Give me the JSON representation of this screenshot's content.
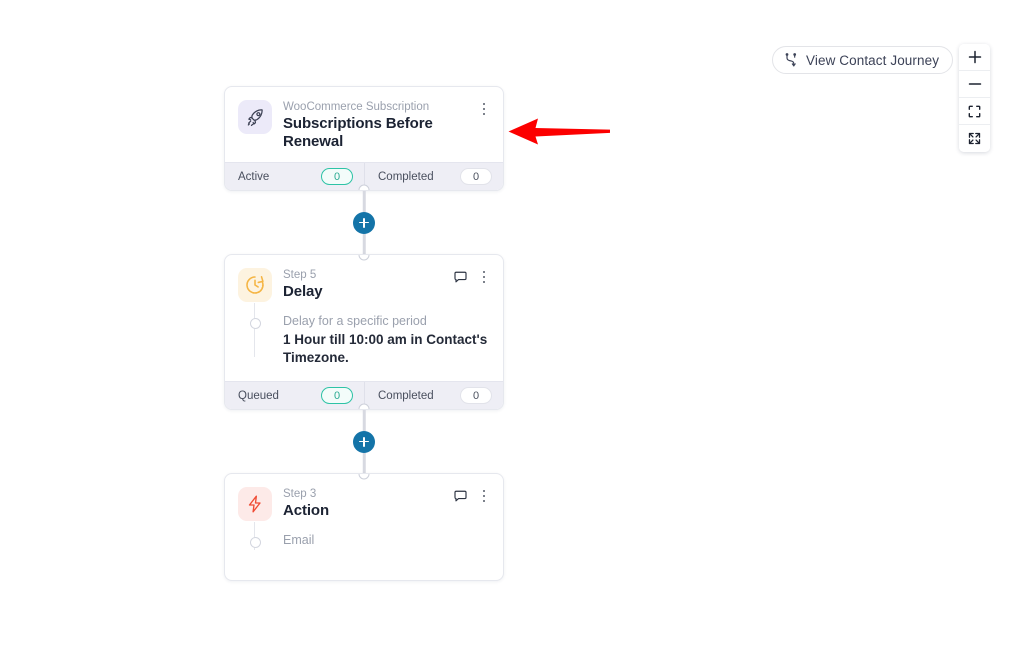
{
  "toolbar": {
    "journey_button": {
      "label": "View Contact Journey",
      "icon": "branch-flow-icon"
    },
    "zoom_controls": [
      {
        "name": "zoom-in",
        "icon": "plus-icon",
        "label": "+"
      },
      {
        "name": "zoom-out",
        "icon": "minus-icon",
        "label": "−"
      },
      {
        "name": "fit-view",
        "icon": "fit-screen-icon",
        "label": ""
      },
      {
        "name": "expand-view",
        "icon": "expand-arrows-icon",
        "label": ""
      }
    ]
  },
  "flow": {
    "nodes": [
      {
        "type": "trigger",
        "icon": "rocket-icon",
        "eyebrow": "WooCommerce Subscription",
        "title": "Subscriptions Before Renewal",
        "has_comment_icon": false,
        "body": null,
        "stats": [
          {
            "label": "Active",
            "value": "0",
            "style": "green"
          },
          {
            "label": "Completed",
            "value": "0",
            "style": "plain"
          }
        ]
      },
      {
        "type": "delay",
        "icon": "clock-icon",
        "eyebrow": "Step 5",
        "title": "Delay",
        "has_comment_icon": true,
        "body": {
          "sub": "Delay for a specific period",
          "main": "1 Hour till 10:00 am in Contact's Timezone."
        },
        "stats": [
          {
            "label": "Queued",
            "value": "0",
            "style": "green"
          },
          {
            "label": "Completed",
            "value": "0",
            "style": "plain"
          }
        ]
      },
      {
        "type": "action",
        "icon": "lightning-bolt-icon",
        "eyebrow": "Step 3",
        "title": "Action",
        "has_comment_icon": true,
        "body": {
          "sub": "Email",
          "main": ""
        },
        "stats": []
      }
    ],
    "add_buttons": [
      {
        "name": "add-step-button-1",
        "label": "+"
      },
      {
        "name": "add-step-button-2",
        "label": "+"
      }
    ]
  },
  "annotation": {
    "arrow": {
      "name": "red-pointer-arrow",
      "color": "#fc0000",
      "direction": "left",
      "points_to": "Subscriptions Before Renewal"
    }
  },
  "colors": {
    "accent_blue": "#1474a8",
    "badge_green": "#2ec3a6",
    "footer_bg": "#eeeef5",
    "trigger_icon_bg": "#eceaf9",
    "delay_icon_bg": "#fdf3e0",
    "action_icon_bg": "#fdeae8",
    "annotation_red": "#fc0000"
  }
}
